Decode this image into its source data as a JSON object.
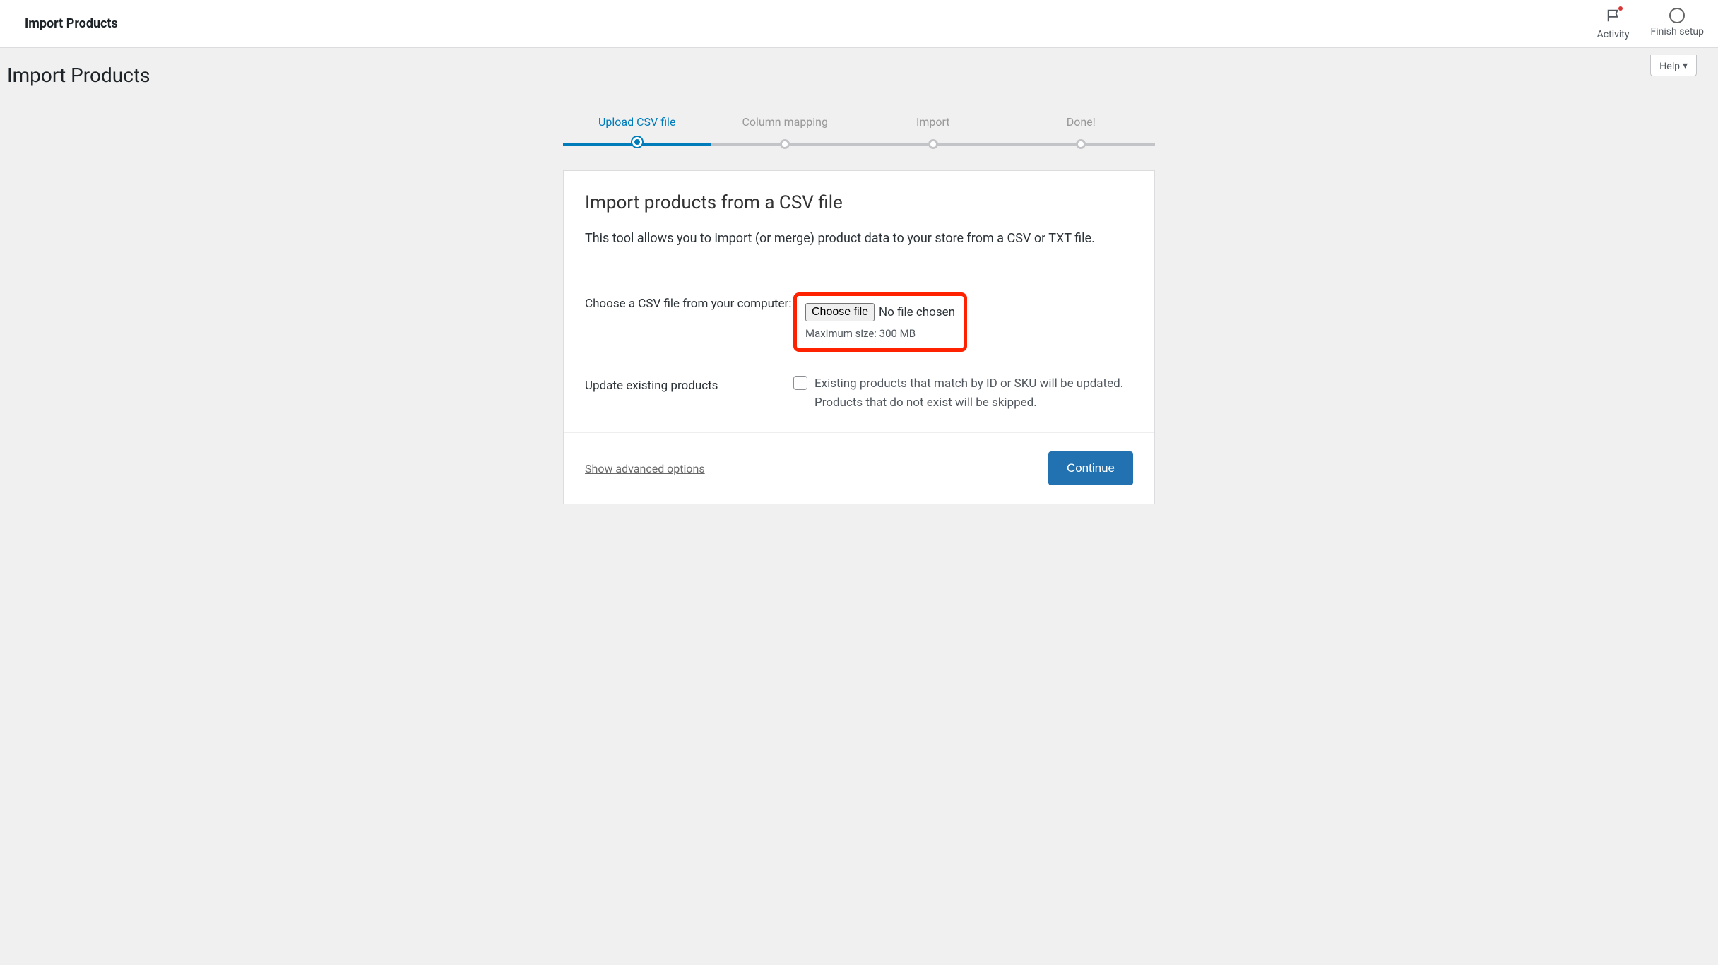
{
  "topbar": {
    "title": "Import Products",
    "activity_label": "Activity",
    "finish_setup_label": "Finish setup"
  },
  "help_button": "Help",
  "page_heading": "Import Products",
  "steps": [
    {
      "label": "Upload CSV file",
      "active": true
    },
    {
      "label": "Column mapping",
      "active": false
    },
    {
      "label": "Import",
      "active": false
    },
    {
      "label": "Done!",
      "active": false
    }
  ],
  "card": {
    "title": "Import products from a CSV file",
    "description": "This tool allows you to import (or merge) product data to your store from a CSV or TXT file.",
    "choose_label": "Choose a CSV file from your computer:",
    "choose_file_btn": "Choose file",
    "no_file_chosen": "No file chosen",
    "max_size": "Maximum size: 300 MB",
    "update_label": "Update existing products",
    "update_desc": "Existing products that match by ID or SKU will be updated. Products that do not exist will be skipped.",
    "advanced_link": "Show advanced options",
    "continue_btn": "Continue"
  }
}
